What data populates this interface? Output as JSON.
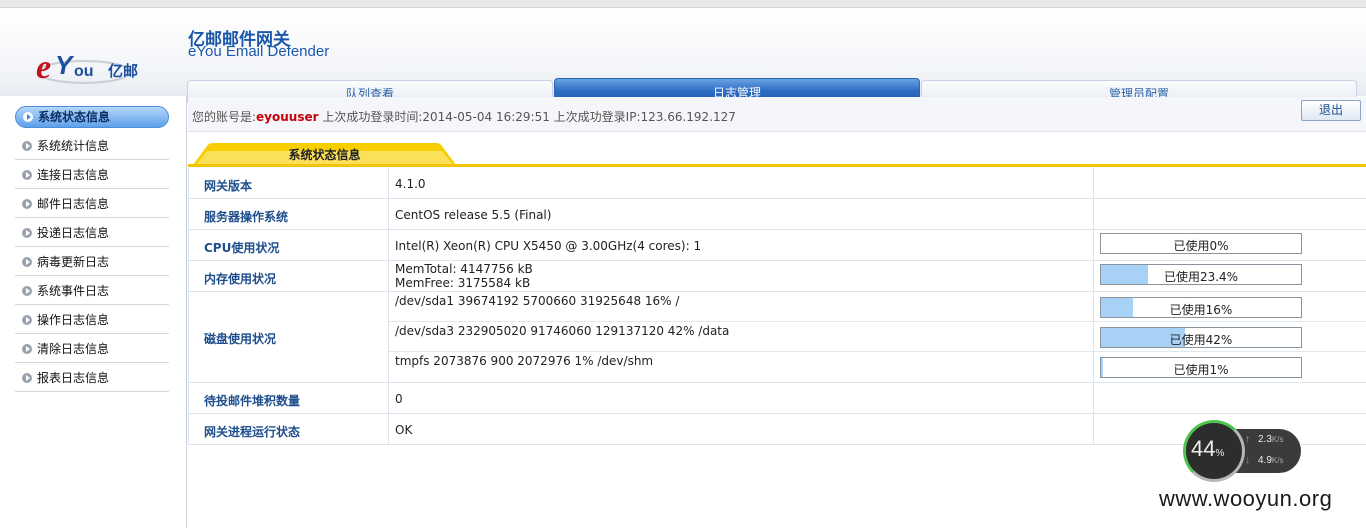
{
  "header": {
    "logo_text": "eYou亿邮",
    "title_cn": "亿邮邮件网关",
    "title_en": "eYou Email Defender"
  },
  "tabs": [
    {
      "label": "队列查看",
      "active": false
    },
    {
      "label": "日志管理",
      "active": true
    },
    {
      "label": "管理员配置",
      "active": false
    }
  ],
  "sidebar": {
    "items": [
      {
        "label": "系统状态信息",
        "active": true
      },
      {
        "label": "系统统计信息",
        "active": false
      },
      {
        "label": "连接日志信息",
        "active": false
      },
      {
        "label": "邮件日志信息",
        "active": false
      },
      {
        "label": "投递日志信息",
        "active": false
      },
      {
        "label": "病毒更新日志",
        "active": false
      },
      {
        "label": "系统事件日志",
        "active": false
      },
      {
        "label": "操作日志信息",
        "active": false
      },
      {
        "label": "清除日志信息",
        "active": false
      },
      {
        "label": "报表日志信息",
        "active": false
      }
    ]
  },
  "account": {
    "prefix": "您的账号是:",
    "username": "eyouuser",
    "last_login": " 上次成功登录时间:2014-05-04 16:29:51 上次成功登录IP:123.66.192.127",
    "logout_label": "退出"
  },
  "section": {
    "title": "系统状态信息"
  },
  "status": {
    "version_label": "网关版本",
    "version": "4.1.0",
    "os_label": "服务器操作系统",
    "os": "CentOS release 5.5 (Final)",
    "cpu_label": "CPU使用状况",
    "cpu": "Intel(R) Xeon(R) CPU X5450 @ 3.00GHz(4 cores): 1",
    "cpu_usage_text": "已使用0%",
    "cpu_usage": 0,
    "mem_label": "内存使用状况",
    "mem_total": "MemTotal: 4147756 kB",
    "mem_free": "MemFree: 3175584 kB",
    "mem_usage_text": "已使用23.4%",
    "mem_usage": 23.4,
    "disk_label": "磁盘使用状况",
    "disks": [
      {
        "line": "/dev/sda1 39674192 5700660 31925648 16% /",
        "usage_text": "已使用16%",
        "usage": 16
      },
      {
        "line": "/dev/sda3 232905020 91746060 129137120 42% /data",
        "usage_text": "已使用42%",
        "usage": 42
      },
      {
        "line": "tmpfs 2073876 900 2072976 1% /dev/shm",
        "usage_text": "已使用1%",
        "usage": 1
      }
    ],
    "queue_label": "待投邮件堆积数量",
    "queue": "0",
    "process_label": "网关进程运行状态",
    "process": "OK"
  },
  "widget": {
    "percent": "44",
    "percent_unit": "%",
    "up": "2.3",
    "down": "4.9",
    "unit": "K/s"
  },
  "watermark": "www.wooyun.org"
}
